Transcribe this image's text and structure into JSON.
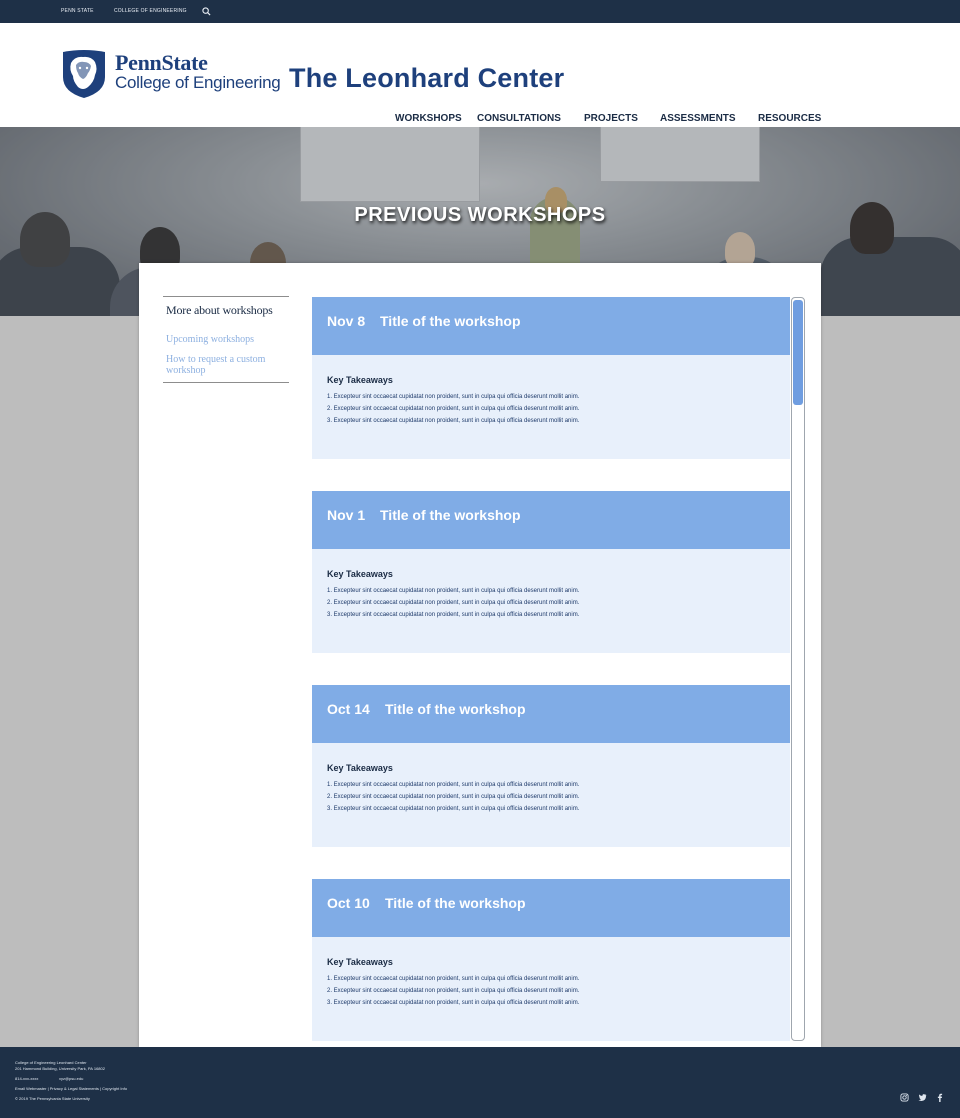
{
  "topbar": {
    "links": [
      "PENN STATE",
      "COLLEGE OF ENGINEERING"
    ],
    "search_icon": "search-icon"
  },
  "header": {
    "logo_line1": "PennState",
    "logo_line2": "College of Engineering",
    "site_title": "The Leonhard Center",
    "nav": [
      "WORKSHOPS",
      "CONSULTATIONS",
      "PROJECTS",
      "ASSESSMENTS",
      "RESOURCES"
    ]
  },
  "hero": {
    "title": "PREVIOUS WORKSHOPS"
  },
  "sidebar": {
    "heading": "More about workshops",
    "links": [
      "Upcoming workshops",
      "How to request a custom workshop"
    ]
  },
  "workshops": [
    {
      "date": "Nov 8",
      "title": "Title of the workshop",
      "takeaways_label": "Key Takeaways",
      "points": [
        "1. Excepteur sint occaecat cupidatat non proident, sunt in culpa qui officia deserunt mollit anim.",
        "2. Excepteur sint occaecat cupidatat non proident, sunt in culpa qui officia deserunt mollit anim.",
        "3. Excepteur sint occaecat cupidatat non proident, sunt in culpa qui officia deserunt mollit anim."
      ]
    },
    {
      "date": "Nov 1",
      "title": "Title of the workshop",
      "takeaways_label": "Key Takeaways",
      "points": [
        "1. Excepteur sint occaecat cupidatat non proident, sunt in culpa qui officia deserunt mollit anim.",
        "2. Excepteur sint occaecat cupidatat non proident, sunt in culpa qui officia deserunt mollit anim.",
        "3. Excepteur sint occaecat cupidatat non proident, sunt in culpa qui officia deserunt mollit anim."
      ]
    },
    {
      "date": "Oct 14",
      "title": "Title of the workshop",
      "takeaways_label": "Key Takeaways",
      "points": [
        "1. Excepteur sint occaecat cupidatat non proident, sunt in culpa qui officia deserunt mollit anim.",
        "2. Excepteur sint occaecat cupidatat non proident, sunt in culpa qui officia deserunt mollit anim.",
        "3. Excepteur sint occaecat cupidatat non proident, sunt in culpa qui officia deserunt mollit anim."
      ]
    },
    {
      "date": "Oct 10",
      "title": "Title of the workshop",
      "takeaways_label": "Key Takeaways",
      "points": [
        "1. Excepteur sint occaecat cupidatat non proident, sunt in culpa qui officia deserunt mollit anim.",
        "2. Excepteur sint occaecat cupidatat non proident, sunt in culpa qui officia deserunt mollit anim.",
        "3. Excepteur sint occaecat cupidatat non proident, sunt in culpa qui officia deserunt mollit anim."
      ]
    }
  ],
  "footer": {
    "org": "College of Engineering  Leonhard Center",
    "address": "201 Hammond Building, University Park, PA 16802",
    "phone": "814-xxx-xxxx",
    "email": "xyz@psu.edu",
    "links_line": "Email Webmaster | Privacy & Legal Statements | Copyright Info",
    "copyright": "© 2019 The Pennsylvania State University",
    "social_icons": [
      "instagram-icon",
      "twitter-icon",
      "facebook-icon"
    ]
  },
  "colors": {
    "navy": "#1e3047",
    "brand_blue": "#1e407c",
    "card_header": "#80ace6",
    "card_body": "#e8f0fb",
    "link_blue": "#8db0e0"
  }
}
